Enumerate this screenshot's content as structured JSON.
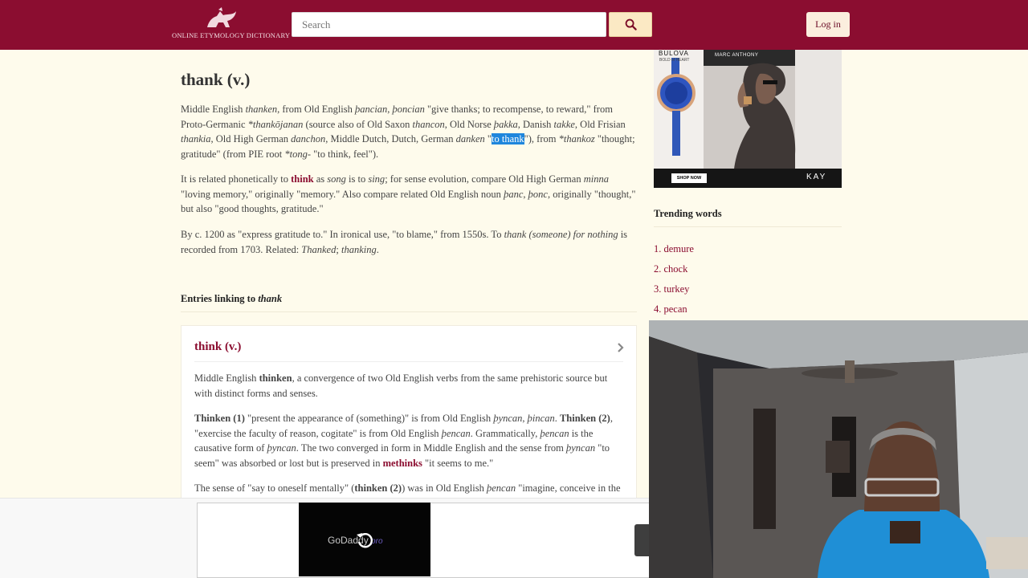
{
  "header": {
    "logo_text": "ONLINE ETYMOLOGY DICTIONARY",
    "search_placeholder": "Search",
    "login_label": "Log in"
  },
  "entry": {
    "title": "thank (v.)",
    "p1": [
      {
        "t": "Middle English "
      },
      {
        "t": "thanken",
        "i": true
      },
      {
        "t": ", from Old English "
      },
      {
        "t": "þancian",
        "i": true
      },
      {
        "t": ", "
      },
      {
        "t": "þoncian",
        "i": true
      },
      {
        "t": " \"give thanks; to recompense, to reward,\" from Proto-Germanic "
      },
      {
        "t": "*thankōjanan",
        "i": true
      },
      {
        "t": " (source also of Old Saxon "
      },
      {
        "t": "thancon",
        "i": true
      },
      {
        "t": ", Old Norse "
      },
      {
        "t": "þakka",
        "i": true
      },
      {
        "t": ", Danish "
      },
      {
        "t": "takke",
        "i": true
      },
      {
        "t": ", Old Frisian "
      },
      {
        "t": "thankia",
        "i": true
      },
      {
        "t": ", Old High German "
      },
      {
        "t": "danchon",
        "i": true
      },
      {
        "t": ", Middle Dutch, Dutch, German "
      },
      {
        "t": "danken",
        "i": true
      },
      {
        "t": " \""
      },
      {
        "t": "to thank",
        "h": true
      },
      {
        "t": "\"), from "
      },
      {
        "t": "*thankoz",
        "i": true
      },
      {
        "t": " \"thought; gratitude\" (from PIE root "
      },
      {
        "t": "*tong-",
        "i": true
      },
      {
        "t": " \"to think, feel\")."
      }
    ],
    "p2": [
      {
        "t": "It is related phonetically to "
      },
      {
        "t": "think",
        "l": true
      },
      {
        "t": " as "
      },
      {
        "t": "song",
        "i": true
      },
      {
        "t": " is to "
      },
      {
        "t": "sing",
        "i": true
      },
      {
        "t": "; for sense evolution, compare Old High German "
      },
      {
        "t": "minna",
        "i": true
      },
      {
        "t": " \"loving memory,\" originally \"memory.\" Also compare related Old English noun "
      },
      {
        "t": "þanc",
        "i": true
      },
      {
        "t": ", "
      },
      {
        "t": "þonc",
        "i": true
      },
      {
        "t": ", originally \"thought,\" but also \"good thoughts, gratitude.\""
      }
    ],
    "p3": [
      {
        "t": "By c. 1200 as \"express gratitude to.\" In ironical use, \"to blame,\" from 1550s. To "
      },
      {
        "t": "thank (someone) for nothing",
        "i": true
      },
      {
        "t": " is recorded from 1703. Related: "
      },
      {
        "t": "Thanked",
        "i": true
      },
      {
        "t": "; "
      },
      {
        "t": "thanking",
        "i": true
      },
      {
        "t": "."
      }
    ]
  },
  "linking": {
    "heading_prefix": "Entries linking to ",
    "heading_word": "thank",
    "card": {
      "title": "think (v.)",
      "p1": [
        {
          "t": "Middle English "
        },
        {
          "t": "thinken",
          "b": true
        },
        {
          "t": ", a convergence of two Old English verbs from the same prehistoric source but with distinct forms and senses."
        }
      ],
      "p2": [
        {
          "t": "Thinken (1)",
          "b": true
        },
        {
          "t": " \"present the appearance of (something)\" is from Old English "
        },
        {
          "t": "þyncan",
          "i": true
        },
        {
          "t": ", "
        },
        {
          "t": "þincan",
          "i": true
        },
        {
          "t": ". "
        },
        {
          "t": "Thinken (2)",
          "b": true
        },
        {
          "t": ", \"exercise the faculty of reason, cogitate\" is from Old English "
        },
        {
          "t": "þencan",
          "i": true
        },
        {
          "t": ". Grammatically, "
        },
        {
          "t": "þencan",
          "i": true
        },
        {
          "t": " is the causative form of "
        },
        {
          "t": "þyncan",
          "i": true
        },
        {
          "t": ". The two converged in form in Middle English and the sense from "
        },
        {
          "t": "þyncan",
          "i": true
        },
        {
          "t": " \"to seem\" was absorbed or lost but is preserved in "
        },
        {
          "t": "methinks",
          "l": true
        },
        {
          "t": " \"it seems to me.\""
        }
      ],
      "p3": [
        {
          "t": "The sense of \"say to oneself mentally\" ("
        },
        {
          "t": "thinken (2)",
          "b": true
        },
        {
          "t": ") was in Old English "
        },
        {
          "t": "þencan",
          "i": true
        },
        {
          "t": " \"imagine, conceive in the"
        }
      ]
    }
  },
  "sidebar": {
    "ad": {
      "brand": "BULOVA",
      "tagline": "BOLD of HEART",
      "name": "MARC ANTHONY",
      "cta": "SHOP NOW",
      "store": "KAY"
    },
    "trending_heading": "Trending words",
    "trending": [
      "1. demure",
      "2. chock",
      "3. turkey",
      "4. pecan"
    ]
  },
  "bottom_ad": {
    "brand": "GoDaddy",
    "brand_suffix": "pro"
  },
  "colors": {
    "brand": "#8b0d30",
    "background": "#fefbec",
    "selection": "#1f86dc"
  }
}
